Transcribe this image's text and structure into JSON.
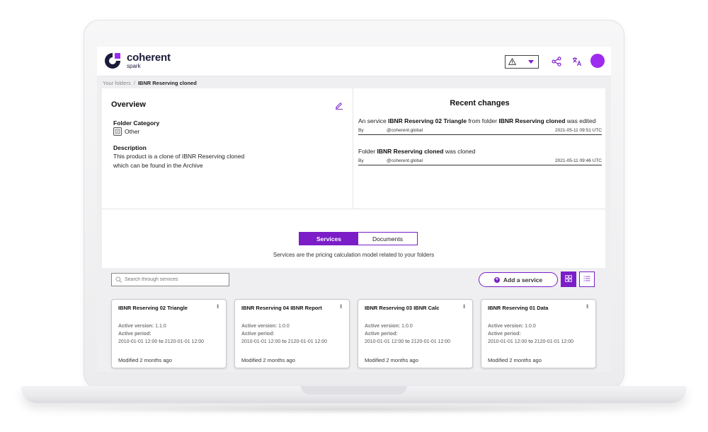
{
  "app": {
    "logo_title": "coherent",
    "logo_subtitle": "spark",
    "brand_color": "#7b1ec8",
    "avatar_color": "#9e2bf0"
  },
  "header": {
    "warning_icon": "warning-icon",
    "share_icon": "share-icon",
    "translate_icon": "translate-icon"
  },
  "breadcrumb": {
    "root": "Your folders",
    "separator": "/",
    "current": "IBNR Reserving cloned"
  },
  "overview": {
    "title": "Overview",
    "folder_category_label": "Folder Category",
    "folder_category_value": "Other",
    "description_label": "Description",
    "description_line1": "This product is a clone of IBNR Reserving cloned",
    "description_line2": "which can be found in the Archive"
  },
  "recent": {
    "title": "Recent changes",
    "items": [
      {
        "t1": "An service ",
        "b1": "IBNR Reserving 02 Triangle",
        "t2": " from folder ",
        "b2": "IBNR Reserving cloned",
        "t3": " was edited",
        "by": "By",
        "who": "@coherent.global",
        "when": "2021-05-11 09:51 UTC"
      },
      {
        "t1": "Folder ",
        "b1": "IBNR Reserving cloned",
        "t2": " was cloned",
        "b2": "",
        "t3": "",
        "by": "By",
        "who": "@coherent.global",
        "when": "2021-05-11 09:46 UTC"
      }
    ]
  },
  "tabs": {
    "services": "Services",
    "documents": "Documents",
    "caption": "Services are the pricing calculation model related to your folders"
  },
  "toolbar": {
    "search_placeholder": "Search through services",
    "add_label": "Add a service"
  },
  "cards": [
    {
      "title": "IBNR Reserving 02 Triangle",
      "active_version_label": "Active version:",
      "active_version": "1.1.0",
      "active_period_label": "Active period:",
      "period_from": "2010-01-01 12:00",
      "period_to_word": "to",
      "period_to": "2120-01-01 12:00",
      "modified": "Modified 2 months ago"
    },
    {
      "title": "IBNR Reserving 04 IBNR Report",
      "active_version_label": "Active version:",
      "active_version": "1.0.0",
      "active_period_label": "Active period:",
      "period_from": "2010-01-01 12:00",
      "period_to_word": "to",
      "period_to": "2120-01-01 12:00",
      "modified": "Modified 2 months ago"
    },
    {
      "title": "IBNR Reserving 03 IBNR Calc",
      "active_version_label": "Active version:",
      "active_version": "1.0.0",
      "active_period_label": "Active period:",
      "period_from": "2010-01-01 12:00",
      "period_to_word": "to",
      "period_to": "2120-01-01 12:00",
      "modified": "Modified 2 months ago"
    },
    {
      "title": "IBNR Reserving 01 Data",
      "active_version_label": "Active version:",
      "active_version": "1.0.0",
      "active_period_label": "Active period:",
      "period_from": "2010-01-01 12:00",
      "period_to_word": "to",
      "period_to": "2120-01-01 12:00",
      "modified": "Modified 2 months ago"
    }
  ]
}
